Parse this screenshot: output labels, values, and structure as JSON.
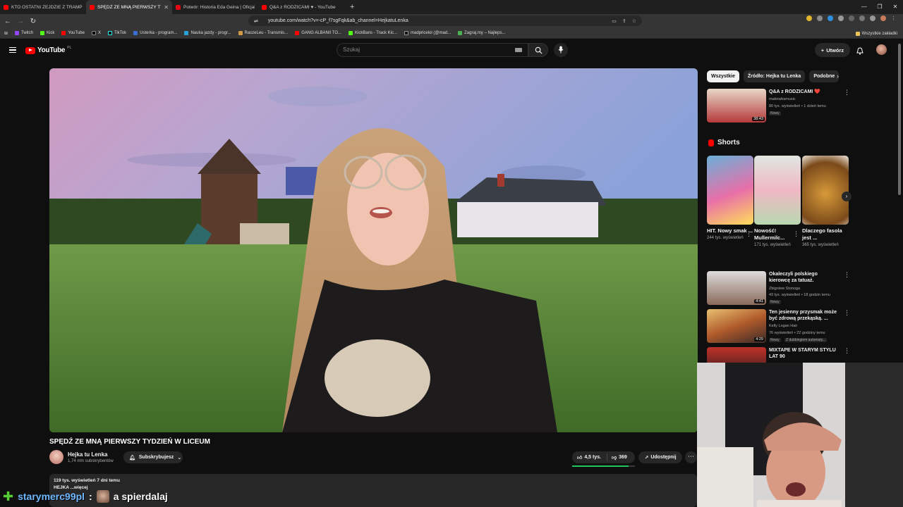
{
  "browser": {
    "tabs": [
      {
        "title": "KTO OSTATNI ZEJDZIE Z TRAMPOLI",
        "active": false
      },
      {
        "title": "SPĘDŹ ZE MNĄ PIERWSZY TY",
        "active": true
      },
      {
        "title": "Potwór: Historia Eda Geina | Oficjaln",
        "active": false
      },
      {
        "title": "Q&A z RODZICAMI ♥ - YouTube",
        "active": false
      }
    ],
    "url": "youtube.com/watch?v=-cP_f7sgFqk&ab_channel=HejkatuLenka",
    "bookmarks": [
      "Twitch",
      "Kick",
      "YouTube",
      "X",
      "TikTok",
      "Usterka - program...",
      "Nauka jazdy - progr...",
      "RaszeLeu - Transmis...",
      "GANG ALBANII TO...",
      "KickBans - Track Kic...",
      "madpricelol (@mad...",
      "Zagraj.my – Najleps..."
    ],
    "bookmarks_all": "Wszystkie zakładki"
  },
  "youtube": {
    "logo": "YouTube",
    "logo_country": "PL",
    "search_placeholder": "Szukaj",
    "create_label": "Utwórz"
  },
  "video": {
    "title": "SPĘDŹ ZE MNĄ PIERWSZY TYDZIEŃ W LICEUM",
    "channel": "Hejka tu Lenka",
    "subscribers": "1,74 mln subskrybentów",
    "subscribed_label": "Subskrybujesz",
    "likes": "4,5 tys.",
    "dislikes": "369",
    "like_ratio": 0.9,
    "share_label": "Udostępnij",
    "views_date": "119 tys. wyświetleń  7 dni temu",
    "description": "HEJKA ...więcej"
  },
  "sidebar": {
    "chips": [
      "Wszystkie",
      "Źródło: Hejka tu Lenka",
      "Podobne"
    ],
    "top_rec": {
      "title": "Q&A z RODZICAMI ❤️",
      "channel": "makowkamusic",
      "meta": "80 tys. wyświetleń • 1 dzień temu",
      "badge": "Nowy",
      "duration": "38:43"
    },
    "shorts_title": "Shorts",
    "shorts": [
      {
        "title": "HIT. Nowy smak ...",
        "views": "244 tys. wyświetleń"
      },
      {
        "title": "Nowość! Mullermilc...",
        "views": "171 tys. wyświetleń"
      },
      {
        "title": "Dlaczego fasola jest ...",
        "views": "365 tys. wyświetleń"
      }
    ],
    "recs": [
      {
        "title": "Okaleczyli polskiego kierowcę za tatuaż.",
        "channel": "Zbigniew Stonoga",
        "meta": "43 tys. wyświetleń • 18 godzin temu",
        "badge": "Nowy",
        "duration": "4:41"
      },
      {
        "title": "Ten jesienny przysmak może być zdrową przekąską. ...",
        "channel": "Kelly Logan Hair",
        "meta": "76 wyświetleń • 22 godziny temu",
        "badge": "Nowy",
        "badge2": "Z dubbingiem automaty...",
        "duration": "4:29"
      },
      {
        "title": "MIXTAPE W STARYM STYLU LAT 90",
        "channel": "",
        "meta": "",
        "duration": ""
      }
    ]
  },
  "chat": {
    "user": "starymerc99pl",
    "separator": ":",
    "message": "a spierdalaj"
  },
  "colors": {
    "youtube_red": "#ff0000",
    "like_bar": "#22c55e",
    "chat_user": "#6fb8ff"
  }
}
